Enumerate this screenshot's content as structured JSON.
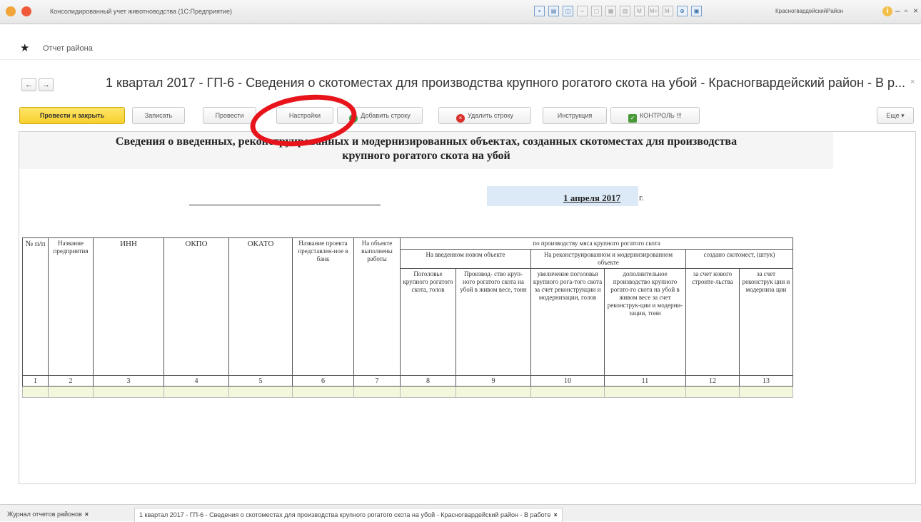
{
  "window": {
    "title": "Консолидированный учет животноводства (1С:Предприятие)",
    "user": "КрасногвардейскийРайон",
    "info_icon": "info-icon"
  },
  "section": {
    "title": "Отчет района"
  },
  "document": {
    "title": "1 квартал 2017 - ГП-6 - Сведения о скотоместах для производства крупного рогатого скота на убой - Красногвардейский район - В р...",
    "close": "×"
  },
  "toolbar": {
    "post_close": "Провести и закрыть",
    "save": "Записать",
    "post": "Провести",
    "settings": "Настройки",
    "add_row": "Добавить строку",
    "delete_row": "Удалить строку",
    "instruction": "Инструкция",
    "control": "КОНТРОЛЬ !!!",
    "more": "Еще ▾"
  },
  "report": {
    "header_line1": "Сведения о введенных, реконструированных и модернизированных объектах, созданных скотоместах для производства",
    "header_line2": "крупного рогатого скота на убой",
    "date": "1 апреля 2017",
    "date_suffix": "г."
  },
  "table": {
    "col_no": "№ п/п",
    "col_name": "Название предприятия",
    "col_inn": "ИНН",
    "col_okpo": "ОКПО",
    "col_okato": "ОКАТО",
    "col_project": "Название проекта представлен-ное в банк",
    "col_works": "На объекте выполнены работы",
    "group_main": "по производству мяса крупного рогатого скота",
    "group_new": "На введенном новом объекте",
    "group_recon": "На реконструированном и модернизированном объекте",
    "group_places": "создано скотомест, (штук)",
    "c8": "Поголовье крупного рогатого скота, голов",
    "c9": "Производ- ство круп- ного рогатого скота на убой в живом весе, тонн",
    "c10": "увеличение поголовья крупного рога-того скота за счет реконструкции и модернизации, голов",
    "c11": "дополнительное производство крупного рогато-го скота на убой в живом весе за счет реконструк-ции и модерни-зации, тонн",
    "c12": "за счет нового строите-льства",
    "c13": "за счет реконструк ции и модерниза ции",
    "numbers": [
      "1",
      "2",
      "3",
      "4",
      "5",
      "6",
      "7",
      "8",
      "9",
      "10",
      "11",
      "12",
      "13"
    ]
  },
  "tabs": [
    {
      "label": "Журнал отчетов районов"
    },
    {
      "label": "1 квартал 2017 - ГП-6 - Сведения о скотоместах для производства крупного рогатого скота на убой - Красногвардейский район - В работе"
    }
  ],
  "colors": {
    "primary_button": "#f7cf2c",
    "annotation_circle": "#e8141c",
    "date_highlight": "#dceaf7",
    "empty_row": "#f3f7dc"
  }
}
